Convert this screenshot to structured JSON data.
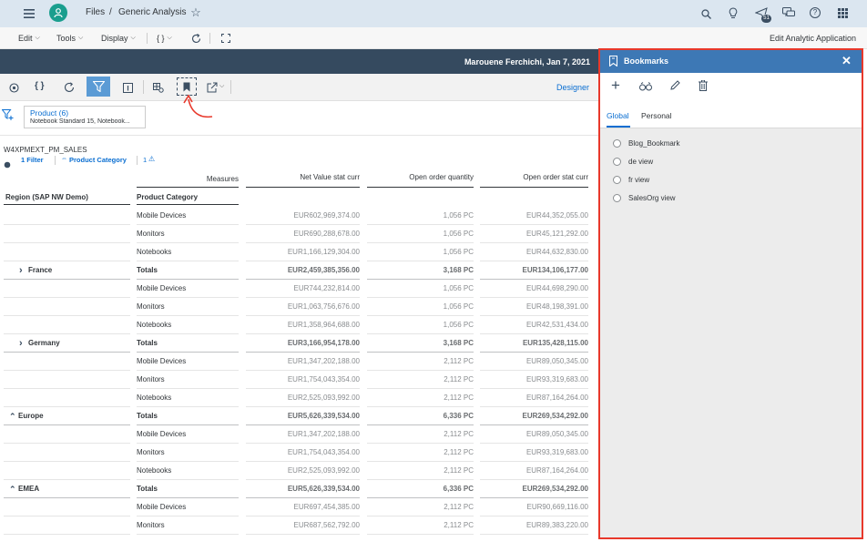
{
  "shell": {
    "breadcrumb_files": "Files",
    "breadcrumb_sep": "/",
    "title": "Generic Analysis",
    "notification_count": "51",
    "icons": [
      "menu-icon",
      "avatar-icon",
      "star-icon",
      "search-icon",
      "lightbulb-icon",
      "notification-icon",
      "chat-icon",
      "help-icon",
      "apps-grid-icon"
    ]
  },
  "toolbar": {
    "edit": "Edit",
    "tools": "Tools",
    "display": "Display",
    "code": "{ }",
    "edit_app": "Edit Analytic Application"
  },
  "infobar": {
    "text": "Marouene Ferchichi, Jan 7, 2021"
  },
  "actionbar": {
    "designer": "Designer"
  },
  "filter": {
    "title": "Product (6)",
    "value": "Notebook Standard 15, Notebook..."
  },
  "table_meta": {
    "source": "W4XPMEXT_PM_SALES",
    "filter_count": "1 Filter",
    "product_category": "Product Category",
    "warning": "1"
  },
  "table": {
    "measures_label": "Measures",
    "columns": [
      "Net Value stat curr",
      "Open order quantity",
      "Open order stat curr"
    ],
    "dim_headers": [
      "Region (SAP NW Demo)",
      "Product Category"
    ],
    "rows": [
      {
        "region": "",
        "region_icon": "",
        "product": "Mobile Devices",
        "v1": "EUR602,969,374.00",
        "v2": "1,056 PC",
        "v3": "EUR44,352,055.00",
        "bold": false
      },
      {
        "region": "",
        "region_icon": "",
        "product": "Monitors",
        "v1": "EUR690,288,678.00",
        "v2": "1,056 PC",
        "v3": "EUR45,121,292.00",
        "bold": false
      },
      {
        "region": "",
        "region_icon": "",
        "product": "Notebooks",
        "v1": "EUR1,166,129,304.00",
        "v2": "1,056 PC",
        "v3": "EUR44,632,830.00",
        "bold": false
      },
      {
        "region": "France",
        "region_icon": "›",
        "product": "Totals",
        "v1": "EUR2,459,385,356.00",
        "v2": "3,168 PC",
        "v3": "EUR134,106,177.00",
        "bold": true
      },
      {
        "region": "",
        "region_icon": "",
        "product": "Mobile Devices",
        "v1": "EUR744,232,814.00",
        "v2": "1,056 PC",
        "v3": "EUR44,698,290.00",
        "bold": false
      },
      {
        "region": "",
        "region_icon": "",
        "product": "Monitors",
        "v1": "EUR1,063,756,676.00",
        "v2": "1,056 PC",
        "v3": "EUR48,198,391.00",
        "bold": false
      },
      {
        "region": "",
        "region_icon": "",
        "product": "Notebooks",
        "v1": "EUR1,358,964,688.00",
        "v2": "1,056 PC",
        "v3": "EUR42,531,434.00",
        "bold": false
      },
      {
        "region": "Germany",
        "region_icon": "›",
        "product": "Totals",
        "v1": "EUR3,166,954,178.00",
        "v2": "3,168 PC",
        "v3": "EUR135,428,115.00",
        "bold": true
      },
      {
        "region": "",
        "region_icon": "",
        "product": "Mobile Devices",
        "v1": "EUR1,347,202,188.00",
        "v2": "2,112 PC",
        "v3": "EUR89,050,345.00",
        "bold": false
      },
      {
        "region": "",
        "region_icon": "",
        "product": "Monitors",
        "v1": "EUR1,754,043,354.00",
        "v2": "2,112 PC",
        "v3": "EUR93,319,683.00",
        "bold": false
      },
      {
        "region": "",
        "region_icon": "",
        "product": "Notebooks",
        "v1": "EUR2,525,093,992.00",
        "v2": "2,112 PC",
        "v3": "EUR87,164,264.00",
        "bold": false
      },
      {
        "region": "Europe",
        "region_icon": "^",
        "product": "Totals",
        "v1": "EUR5,626,339,534.00",
        "v2": "6,336 PC",
        "v3": "EUR269,534,292.00",
        "bold": true
      },
      {
        "region": "",
        "region_icon": "",
        "product": "Mobile Devices",
        "v1": "EUR1,347,202,188.00",
        "v2": "2,112 PC",
        "v3": "EUR89,050,345.00",
        "bold": false
      },
      {
        "region": "",
        "region_icon": "",
        "product": "Monitors",
        "v1": "EUR1,754,043,354.00",
        "v2": "2,112 PC",
        "v3": "EUR93,319,683.00",
        "bold": false
      },
      {
        "region": "",
        "region_icon": "",
        "product": "Notebooks",
        "v1": "EUR2,525,093,992.00",
        "v2": "2,112 PC",
        "v3": "EUR87,164,264.00",
        "bold": false
      },
      {
        "region": "EMEA",
        "region_icon": "^",
        "product": "Totals",
        "v1": "EUR5,626,339,534.00",
        "v2": "6,336 PC",
        "v3": "EUR269,534,292.00",
        "bold": true
      },
      {
        "region": "",
        "region_icon": "",
        "product": "Mobile Devices",
        "v1": "EUR697,454,385.00",
        "v2": "2,112 PC",
        "v3": "EUR90,669,116.00",
        "bold": false
      },
      {
        "region": "",
        "region_icon": "",
        "product": "Monitors",
        "v1": "EUR687,562,792.00",
        "v2": "2,112 PC",
        "v3": "EUR89,383,220.00",
        "bold": false
      }
    ]
  },
  "bookmarks": {
    "title": "Bookmarks",
    "tabs": [
      "Global",
      "Personal"
    ],
    "active_tab": "Global",
    "items": [
      "Blog_Bookmark",
      "de view",
      "fr view",
      "SalesOrg view"
    ],
    "accent": "#0a6ed1",
    "highlight": "#e8382b"
  }
}
